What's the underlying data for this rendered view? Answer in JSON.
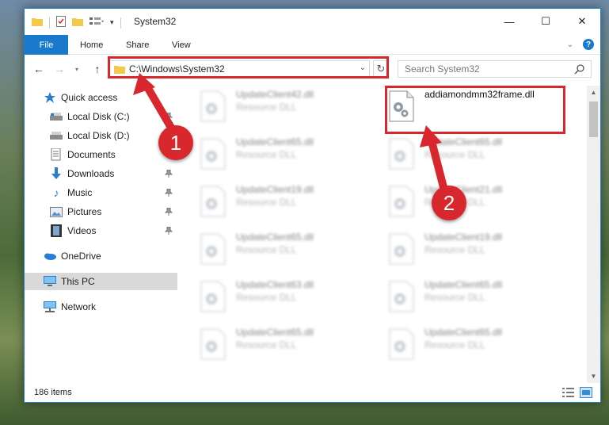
{
  "window": {
    "title": "System32",
    "tabs": {
      "file": "File",
      "home": "Home",
      "share": "Share",
      "view": "View"
    },
    "address": "C:\\Windows\\System32",
    "search_placeholder": "Search System32"
  },
  "sidebar": {
    "quick_access": "Quick access",
    "items": [
      {
        "label": "Local Disk (C:)",
        "icon": "drive-icon",
        "pinned": true
      },
      {
        "label": "Local Disk (D:)",
        "icon": "drive-icon",
        "pinned": false
      },
      {
        "label": "Documents",
        "icon": "documents-icon",
        "pinned": true
      },
      {
        "label": "Downloads",
        "icon": "downloads-icon",
        "pinned": true
      },
      {
        "label": "Music",
        "icon": "music-icon",
        "pinned": true
      },
      {
        "label": "Pictures",
        "icon": "pictures-icon",
        "pinned": true
      },
      {
        "label": "Videos",
        "icon": "videos-icon",
        "pinned": true
      }
    ],
    "onedrive": "OneDrive",
    "this_pc": "This PC",
    "network": "Network"
  },
  "files": {
    "left": [
      {
        "name": "UpdateClient42.dll",
        "type": "Resource DLL"
      },
      {
        "name": "UpdateClient65.dll",
        "type": "Resource DLL"
      },
      {
        "name": "UpdateClient19.dll",
        "type": "Resource DLL"
      },
      {
        "name": "UpdateClient65.dll",
        "type": "Resource DLL"
      },
      {
        "name": "UpdateClient63.dll",
        "type": "Resource DLL"
      },
      {
        "name": "UpdateClient65.dll",
        "type": "Resource DLL"
      }
    ],
    "right": [
      {
        "name": "addiamondmm32frame.dll",
        "type": ""
      },
      {
        "name": "UpdateClient65.dll",
        "type": "Resource DLL"
      },
      {
        "name": "UpdateClient21.dll",
        "type": "Resource DLL"
      },
      {
        "name": "UpdateClient19.dll",
        "type": "Resource DLL"
      },
      {
        "name": "UpdateClient65.dll",
        "type": "Resource DLL"
      },
      {
        "name": "UpdateClient65.dll",
        "type": "Resource DLL"
      }
    ]
  },
  "status": {
    "item_count": "186 items"
  },
  "annotations": {
    "step1": "1",
    "step2": "2",
    "color": "#d9272e"
  },
  "colors": {
    "accent": "#1979ca",
    "selected": "#d9d9d9"
  }
}
